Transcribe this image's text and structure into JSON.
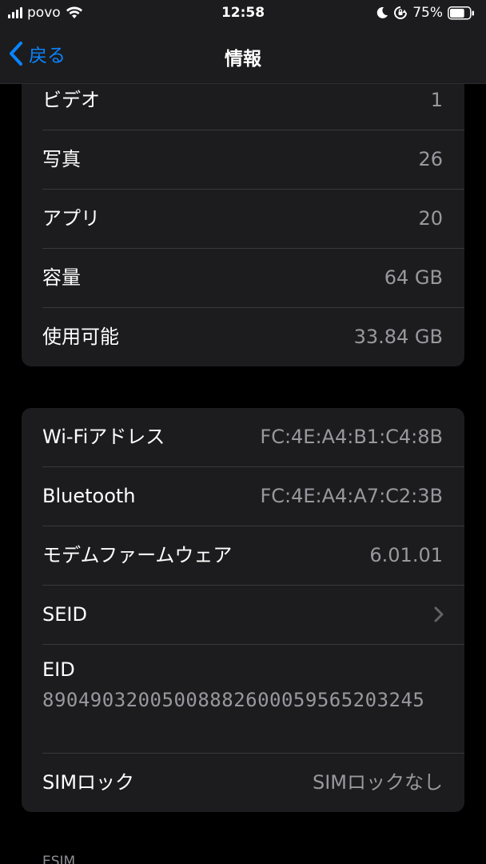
{
  "status_bar": {
    "carrier": "povo",
    "time": "12:58",
    "battery_percent": "75%",
    "battery_level": 0.75
  },
  "nav": {
    "back_label": "戻る",
    "title": "情報"
  },
  "group1": {
    "rows": [
      {
        "label": "ビデオ",
        "value": "1"
      },
      {
        "label": "写真",
        "value": "26"
      },
      {
        "label": "アプリ",
        "value": "20"
      },
      {
        "label": "容量",
        "value": "64 GB"
      },
      {
        "label": "使用可能",
        "value": "33.84 GB"
      }
    ]
  },
  "group2": {
    "wifi": {
      "label": "Wi-Fiアドレス",
      "value": "FC:4E:A4:B1:C4:8B"
    },
    "bluetooth": {
      "label": "Bluetooth",
      "value": "FC:4E:A4:A7:C2:3B"
    },
    "modem": {
      "label": "モデムファームウェア",
      "value": "6.01.01"
    },
    "seid": {
      "label": "SEID"
    },
    "eid": {
      "label": "EID",
      "value": "89049032005008882600059565203245"
    },
    "sim_lock": {
      "label": "SIMロック",
      "value": "SIMロックなし"
    }
  },
  "footer": {
    "esim_header": "ESIM"
  },
  "icons": {
    "signal": "cellular-signal-icon",
    "wifi": "wifi-icon",
    "moon": "do-not-disturb-icon",
    "rotation_lock": "rotation-lock-icon",
    "battery": "battery-icon",
    "back": "chevron-left-icon",
    "disclosure": "chevron-right-icon"
  },
  "colors": {
    "accent": "#0a84ff",
    "background": "#000000",
    "cell": "#1c1c1e",
    "secondary_text": "#98989f"
  }
}
